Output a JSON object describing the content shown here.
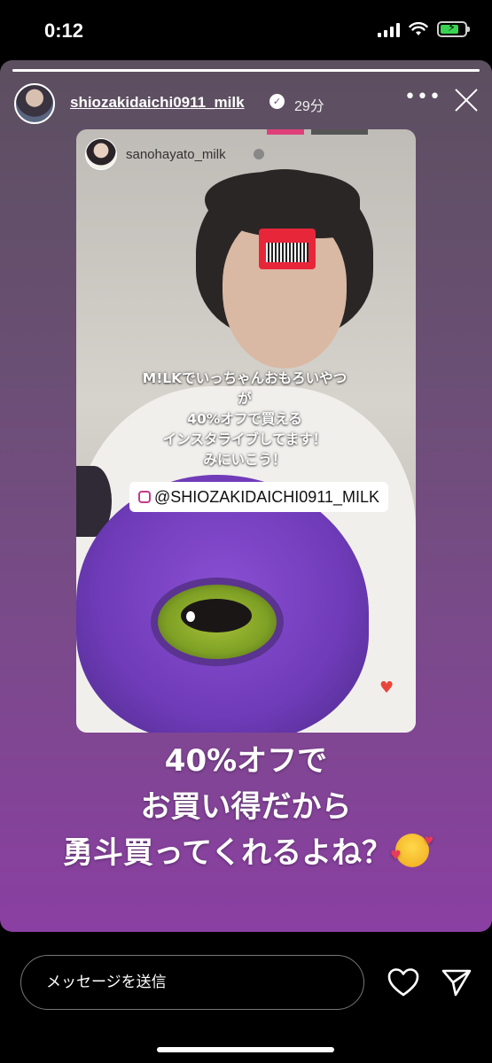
{
  "status_bar": {
    "time": "0:12"
  },
  "story": {
    "username": "shiozakidaichi0911_milk",
    "age": "29分",
    "inner": {
      "username": "sanohayato_milk",
      "overlay_lines": [
        "M!LKでいっちゃんおもろいやつ",
        "が",
        "40%オフで買える",
        "インスタライブしてます！",
        "みにいこう！"
      ],
      "mention": "@SHIOZAKIDAICHI0911_MILK"
    },
    "caption_lines": [
      "40%オフで",
      "お買い得だから",
      "勇斗買ってくれるよね？"
    ]
  },
  "bottom": {
    "message_placeholder": "メッセージを送信"
  },
  "icons": {
    "verified": "verified-badge-icon",
    "more": "more-options-icon",
    "close": "close-icon",
    "like": "heart-outline-icon",
    "share": "paper-plane-icon",
    "emoji": "smiling-face-with-hearts-icon"
  }
}
